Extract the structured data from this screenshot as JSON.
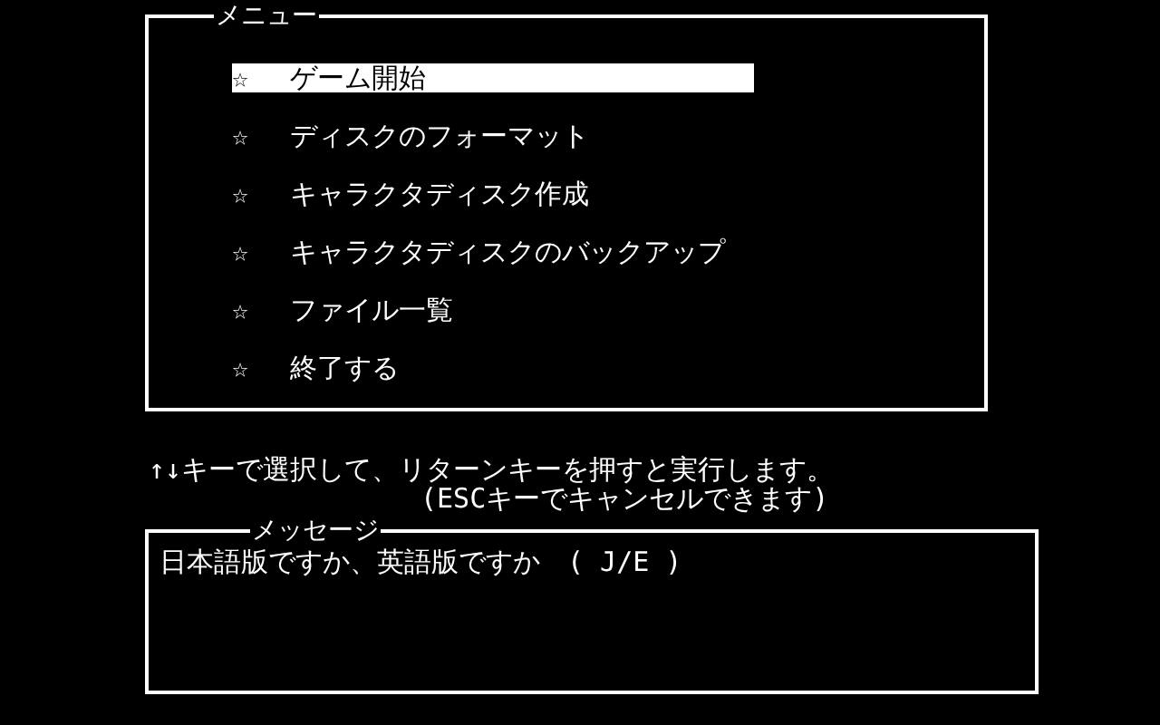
{
  "menu": {
    "title": "メニュー",
    "items": [
      {
        "bullet": "☆",
        "label": "ゲーム開始",
        "selected": true
      },
      {
        "bullet": "☆",
        "label": "ディスクのフォーマット",
        "selected": false
      },
      {
        "bullet": "☆",
        "label": "キャラクタディスク作成",
        "selected": false
      },
      {
        "bullet": "☆",
        "label": "キャラクタディスクのバックアップ",
        "selected": false
      },
      {
        "bullet": "☆",
        "label": "ファイル一覧",
        "selected": false
      },
      {
        "bullet": "☆",
        "label": "終了する",
        "selected": false
      }
    ]
  },
  "hints": [
    "↑↓キーで選択して、リターンキーを押すと実行します。",
    "(ESCキーでキャンセルできます)"
  ],
  "message": {
    "title": "メッセージ",
    "text": "日本語版ですか、英語版ですか　( J/E )"
  }
}
